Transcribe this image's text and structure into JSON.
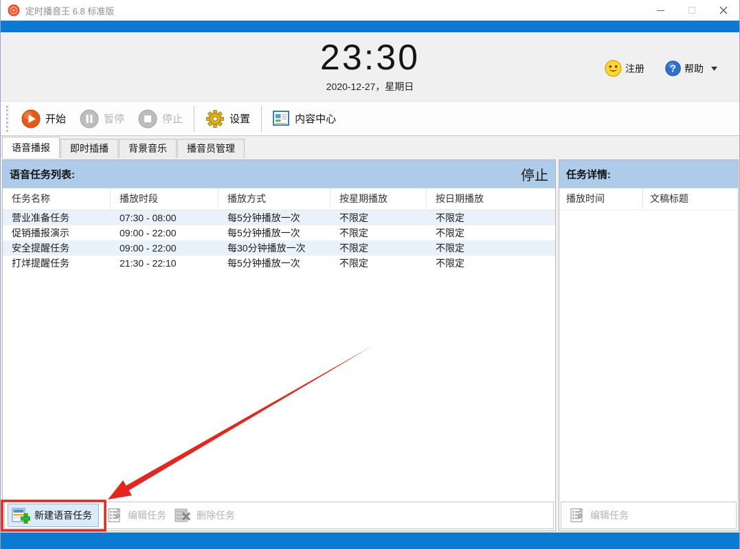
{
  "window": {
    "title": "定时播音王 6.8 标准版"
  },
  "clock": {
    "time": "23:30",
    "date": "2020-12-27，星期日"
  },
  "account": {
    "register": "注册",
    "help": "帮助"
  },
  "toolbar": {
    "start": "开始",
    "pause": "暂停",
    "stop": "停止",
    "settings": "设置",
    "content_center": "内容中心"
  },
  "tabs": [
    {
      "label": "语音播报",
      "active": true
    },
    {
      "label": "即时插播",
      "active": false
    },
    {
      "label": "背景音乐",
      "active": false
    },
    {
      "label": "播音员管理",
      "active": false
    }
  ],
  "task_panel": {
    "title": "语音任务列表:",
    "status": "停止",
    "columns": [
      "任务名称",
      "播放时段",
      "播放方式",
      "按星期播放",
      "按日期播放"
    ],
    "rows": [
      [
        "营业准备任务",
        "07:30 - 08:00",
        "每5分钟播放一次",
        "不限定",
        "不限定"
      ],
      [
        "促销播报演示",
        "09:00 - 22:00",
        "每5分钟播放一次",
        "不限定",
        "不限定"
      ],
      [
        "安全提醒任务",
        "09:00 - 22:00",
        "每30分钟播放一次",
        "不限定",
        "不限定"
      ],
      [
        "打烊提醒任务",
        "21:30 - 22:10",
        "每5分钟播放一次",
        "不限定",
        "不限定"
      ]
    ],
    "buttons": {
      "new": "新建语音任务",
      "edit": "编辑任务",
      "delete": "删除任务"
    }
  },
  "detail_panel": {
    "title": "任务详情:",
    "columns": [
      "播放时间",
      "文稿标题"
    ],
    "buttons": {
      "edit": "编辑任务"
    }
  },
  "icons": {
    "app": "broadcast-logo",
    "minimize": "minimize-line",
    "maximize": "maximize-square",
    "close": "close-x",
    "register": "smiley-face",
    "help": "question-mark-circle",
    "help_dropdown": "caret-down",
    "start": "play-circle-orange",
    "pause": "pause-circle-gray",
    "stop": "stop-circle-gray",
    "settings": "gear-yellow",
    "content_center": "document-blue",
    "new_task": "list-green-plus",
    "edit_task": "list-pencil-gray",
    "delete_task": "list-cross-gray"
  },
  "colors": {
    "accent_blue": "#0b7ad3",
    "panel_header_blue": "#aecbea",
    "row_stripe": "#e9f1fa",
    "annotation_red": "#e5261f",
    "start_orange": "#e35b16",
    "smiley_yellow": "#ffd633"
  }
}
